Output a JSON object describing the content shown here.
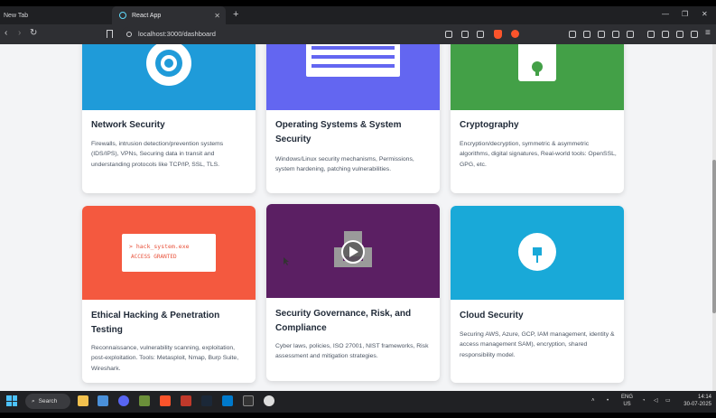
{
  "browser": {
    "tabs": [
      {
        "label": "New Tab",
        "active": false
      },
      {
        "label": "React App",
        "active": true
      }
    ],
    "new_tab_label": "+",
    "url": "localhost:3000/dashboard",
    "window_controls": [
      "—",
      "❐",
      "✕"
    ],
    "nav": {
      "back": "‹",
      "forward": "›",
      "reload": "↻"
    }
  },
  "cards": [
    {
      "title": "Network Security",
      "description": "Firewalls, intrusion detection/prevention systems (IDS/IPS), VPNs, Securing data in transit and understanding protocols like TCP/IP, SSL, TLS.",
      "media_color": "#1f9bd9",
      "icon": "target-icon"
    },
    {
      "title": "Operating Systems & System Security",
      "description": "Windows/Linux security mechanisms, Permissions, system hardening, patching vulnerabilities.",
      "media_color": "#6366f1",
      "icon": "window-icon"
    },
    {
      "title": "Cryptography",
      "description": "Encryption/decryption, symmetric & asymmetric algorithms, digital signatures, Real-world tools: OpenSSL, GPG, etc.",
      "media_color": "#43a047",
      "icon": "padlock-icon"
    },
    {
      "title": "Ethical Hacking & Penetration Testing",
      "description": "Reconnaissance, vulnerability scanning, exploitation, post-exploitation. Tools: Metasploit, Nmap, Burp Suite, Wireshark.",
      "media_color": "#f4593f",
      "icon": "terminal-icon",
      "terminal": {
        "line1": "> hack_system.exe",
        "line2": "ACCESS GRANTED"
      }
    },
    {
      "title": "Security Governance, Risk, and Compliance",
      "description": "Cyber laws, policies, ISO 27001, NIST frameworks, Risk assessment and mitigation strategies.",
      "media_color": "#5b1f63",
      "icon": "document-icon"
    },
    {
      "title": "Cloud Security",
      "description": "Securing AWS, Azure, GCP, IAM management, identity & access management SAM), encryption, shared responsibility model.",
      "media_color": "#19a9d8",
      "icon": "cloud-icon"
    }
  ],
  "taskbar": {
    "search_label": "Search",
    "lang": "ENG",
    "region": "US",
    "time": "14:14",
    "date": "30-07-2025"
  }
}
